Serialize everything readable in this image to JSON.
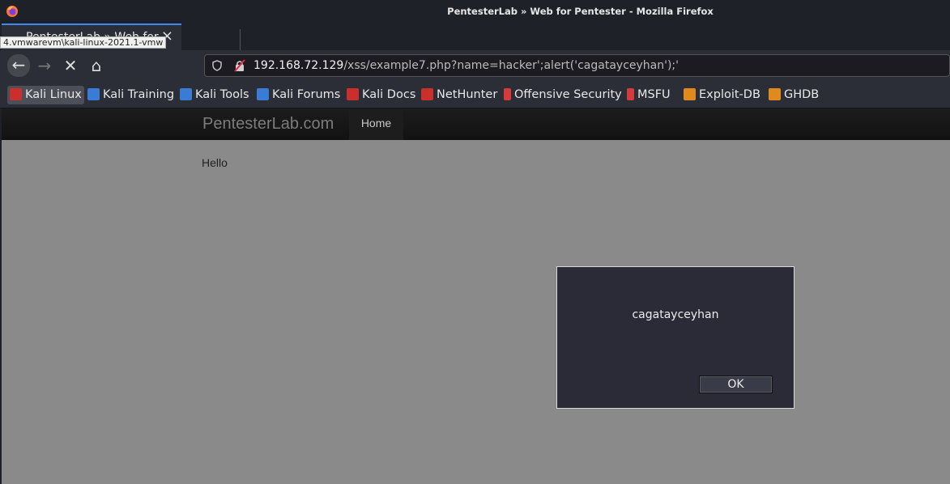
{
  "window": {
    "title": "PentesterLab » Web for Pentester - Mozilla Firefox"
  },
  "tab": {
    "label": "PentesterLab » Web for P",
    "close": "×",
    "new_tab": "+",
    "tooltip": "4.vmwarevm\\kali-linux-2021.1-vmw"
  },
  "nav": {
    "back": "←",
    "forward": "→",
    "stop": "✕",
    "home": "⌂"
  },
  "urlbar": {
    "host": "192.168.72.129",
    "path": "/xss/example7.php?name=hacker';alert('cagatayceyhan');'"
  },
  "bookmarks": [
    {
      "label": "Kali Linux",
      "icon": "kali-dragon-icon",
      "color": "#c9302c"
    },
    {
      "label": "Kali Training",
      "icon": "kali-training-icon",
      "color": "#3a7bd5"
    },
    {
      "label": "Kali Tools",
      "icon": "kali-tools-icon",
      "color": "#3a7bd5"
    },
    {
      "label": "Kali Forums",
      "icon": "kali-forums-icon",
      "color": "#3a7bd5"
    },
    {
      "label": "Kali Docs",
      "icon": "kali-docs-icon",
      "color": "#c9302c"
    },
    {
      "label": "NetHunter",
      "icon": "nethunter-icon",
      "color": "#c9302c"
    },
    {
      "label": "Offensive Security",
      "icon": "offsec-icon",
      "color": "#d63a3a"
    },
    {
      "label": "MSFU",
      "icon": "msfu-icon",
      "color": "#d63a3a"
    },
    {
      "label": "Exploit-DB",
      "icon": "exploit-db-icon",
      "color": "#e08a1e"
    },
    {
      "label": "GHDB",
      "icon": "ghdb-icon",
      "color": "#e08a1e"
    }
  ],
  "page": {
    "brand": "PentesterLab.com",
    "nav_home": "Home",
    "body_text": "Hello"
  },
  "dialog": {
    "message": "cagatayceyhan",
    "ok_label": "OK"
  }
}
